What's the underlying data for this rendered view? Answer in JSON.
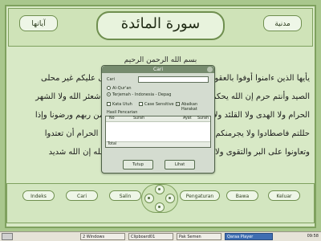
{
  "header": {
    "surah_title": "سورة المائدة",
    "left_badge": "آياتها",
    "right_badge": "مدنية"
  },
  "bismillah": "بسم الله الرحمن الرحيم",
  "verses": [
    "يأيها الذين ءامنوا أوفوا بالعقود أحلت لكم بهيمة الأنعام إلا ما يتلى عليكم غير محلى",
    "الصيد وأنتم حرم إن الله يحكم ما يريد يأيها الذين ءامنوا لا تحلوا شعئر الله ولا الشهر",
    "الحرام ولا الهدى ولا القلئد ولا ءامين البيت الحرام يبتغون فضلا من ربهم ورضونا وإذا",
    "حللتم فاصطادوا ولا يجرمنكم شنان قوم أن صدوكم عن المسجد الحرام أن تعتدوا",
    "وتعاونوا على البر والتقوى ولا تعاونوا على الإثم والعدون واتقوا الله إن الله شديد"
  ],
  "dialog": {
    "title": "Cari",
    "search_label": "Cari",
    "search_value": "",
    "radio_quran": "Al-Qur'an",
    "radio_translation": "Terjemah - Indonesia - Depag",
    "check_whole_word": "Kata Utuh",
    "check_case": "Case Sensitive",
    "check_harakat": "Abaikan Harakat",
    "results_label": "Hasil Pencarian",
    "columns": [
      "No",
      "Surah",
      "Ayat",
      "Surah"
    ],
    "total_label": "Total",
    "close_button": "Tutup",
    "search_button": "Lihat"
  },
  "bottom_bar": {
    "buttons": [
      "Indeks",
      "Cari",
      "Salin",
      "Pengaturan",
      "Bawa",
      "Keluar"
    ]
  },
  "taskbar": {
    "items": [
      "2 Windows",
      "Clipboard01",
      "Pak Semen",
      "Qaraa Player"
    ],
    "clock": "09:58"
  }
}
